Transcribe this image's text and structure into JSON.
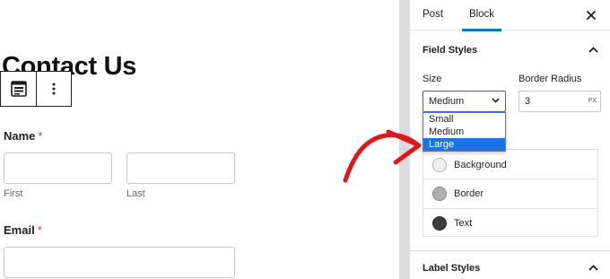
{
  "canvas": {
    "title": "Contact Us",
    "toolbar": {
      "form_icon": "form-block-icon",
      "more_icon": "vertical-ellipsis-icon"
    },
    "name_field": {
      "label": "Name",
      "required": "*",
      "first_label": "First",
      "last_label": "Last"
    },
    "email_field": {
      "label": "Email",
      "required": "*"
    }
  },
  "sidebar": {
    "tabs": [
      "Post",
      "Block"
    ],
    "active_tab": "Block",
    "close_icon": "close-icon",
    "field_styles": {
      "title": "Field Styles",
      "size_label": "Size",
      "size_value": "Medium",
      "size_options": [
        "Small",
        "Medium",
        "Large"
      ],
      "highlighted_option": "Large",
      "border_radius_label": "Border Radius",
      "border_radius_value": "3",
      "border_radius_unit": "PX",
      "colors": [
        {
          "label": "Background",
          "color": "#f0f0f0"
        },
        {
          "label": "Border",
          "color": "#b0b0b0"
        },
        {
          "label": "Text",
          "color": "#3c3c3c"
        }
      ]
    },
    "label_styles": {
      "title": "Label Styles"
    }
  },
  "accent_colors": {
    "tab_underline": "#007cba",
    "select_focus": "#3858e9",
    "option_highlight": "#1a73e8",
    "required": "#d63638",
    "annotation_arrow": "#e2171b"
  }
}
